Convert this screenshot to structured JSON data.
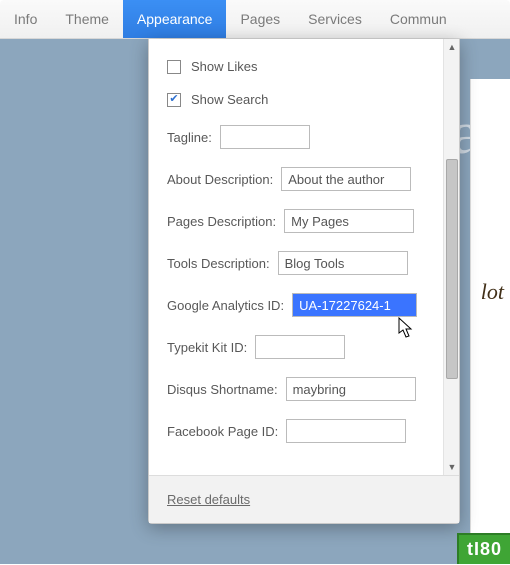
{
  "menu": {
    "items": [
      {
        "label": "Info"
      },
      {
        "label": "Theme"
      },
      {
        "label": "Appearance"
      },
      {
        "label": "Pages"
      },
      {
        "label": "Services"
      },
      {
        "label": "Commun"
      }
    ],
    "active_index": 2
  },
  "panel": {
    "checkboxes": {
      "show_likes": {
        "label": "Show Likes",
        "checked": false
      },
      "show_search": {
        "label": "Show Search",
        "checked": true
      }
    },
    "fields": {
      "tagline": {
        "label": "Tagline:",
        "value": ""
      },
      "about_description": {
        "label": "About Description:",
        "value": "About the author"
      },
      "pages_description": {
        "label": "Pages Description:",
        "value": "My Pages"
      },
      "tools_description": {
        "label": "Tools Description:",
        "value": "Blog Tools"
      },
      "google_analytics_id": {
        "label": "Google Analytics ID:",
        "value": "UA-17227624-1",
        "selected": true
      },
      "typekit_kit_id": {
        "label": "Typekit Kit ID:",
        "value": ""
      },
      "disqus_shortname": {
        "label": "Disqus Shortname:",
        "value": "maybring"
      },
      "facebook_page_id": {
        "label": "Facebook Page ID:",
        "value": ""
      }
    },
    "reset": "Reset defaults"
  },
  "background": {
    "ghost_text": "what",
    "side_text": "lot"
  },
  "badge": "tI80"
}
